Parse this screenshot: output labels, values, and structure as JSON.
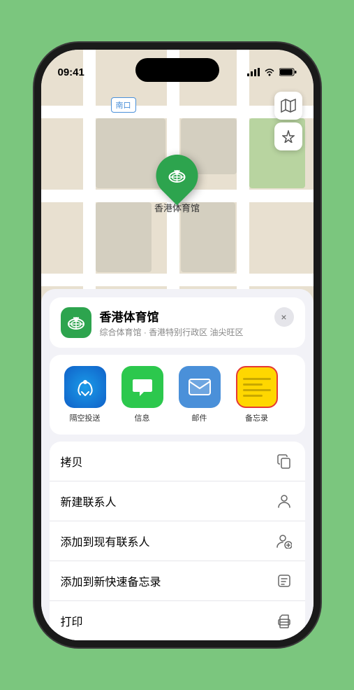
{
  "status_bar": {
    "time": "09:41",
    "location_arrow": "▶"
  },
  "map": {
    "location_label": "南口"
  },
  "venue": {
    "name": "香港体育馆",
    "subtitle": "综合体育馆 · 香港特别行政区 油尖旺区",
    "icon_emoji": "🏟️"
  },
  "share_apps": [
    {
      "id": "airdrop",
      "label": "隔空投送",
      "type": "airdrop"
    },
    {
      "id": "messages",
      "label": "信息",
      "type": "messages"
    },
    {
      "id": "mail",
      "label": "邮件",
      "type": "mail"
    },
    {
      "id": "notes",
      "label": "备忘录",
      "type": "notes"
    }
  ],
  "actions": [
    {
      "id": "copy",
      "label": "拷贝",
      "icon": "copy"
    },
    {
      "id": "new-contact",
      "label": "新建联系人",
      "icon": "person"
    },
    {
      "id": "add-contact",
      "label": "添加到现有联系人",
      "icon": "person-add"
    },
    {
      "id": "add-note",
      "label": "添加到新快速备忘录",
      "icon": "note"
    },
    {
      "id": "print",
      "label": "打印",
      "icon": "print"
    }
  ],
  "close_label": "×"
}
